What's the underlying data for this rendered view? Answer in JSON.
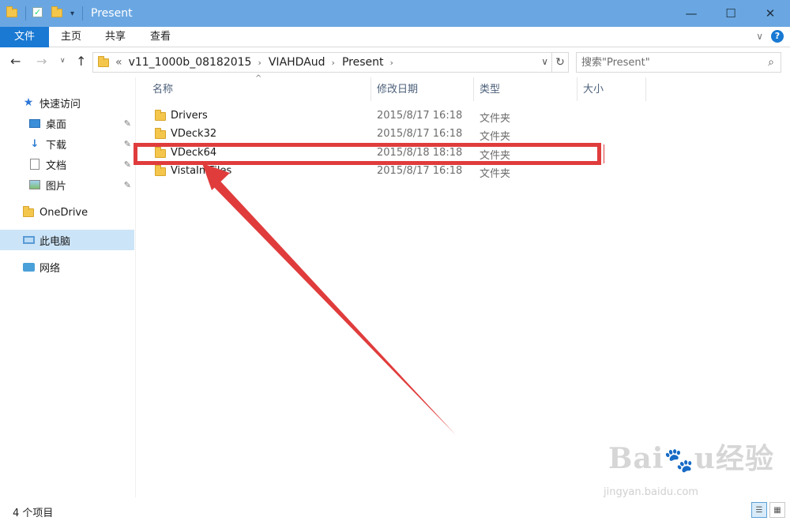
{
  "window": {
    "title": "Present",
    "controls": {
      "minimize": "—",
      "maximize": "☐",
      "close": "✕"
    }
  },
  "ribbon": {
    "tabs": {
      "file": "文件",
      "home": "主页",
      "share": "共享",
      "view": "查看"
    }
  },
  "address": {
    "overflow": "«",
    "crumbs": [
      "v11_1000b_08182015",
      "VIAHDAud",
      "Present"
    ],
    "separator": "›"
  },
  "search": {
    "placeholder": "搜索\"Present\""
  },
  "sidebar": {
    "quick_access": "快速访问",
    "desktop": "桌面",
    "downloads": "下载",
    "documents": "文档",
    "pictures": "图片",
    "onedrive": "OneDrive",
    "this_pc": "此电脑",
    "network": "网络"
  },
  "columns": {
    "name": "名称",
    "date": "修改日期",
    "type": "类型",
    "size": "大小"
  },
  "files": [
    {
      "name": "Drivers",
      "date": "2015/8/17 16:18",
      "type": "文件夹"
    },
    {
      "name": "VDeck32",
      "date": "2015/8/17 16:18",
      "type": "文件夹"
    },
    {
      "name": "VDeck64",
      "date": "2015/8/18 18:18",
      "type": "文件夹"
    },
    {
      "name": "VistaInfFiles",
      "date": "2015/8/17 16:18",
      "type": "文件夹"
    }
  ],
  "status": {
    "count": "4 个项目"
  },
  "annotation_color": "#e03c3c",
  "accent_color": "#1979d3",
  "watermark": {
    "logo": "Baidu经验",
    "url": "jingyan.baidu.com"
  }
}
